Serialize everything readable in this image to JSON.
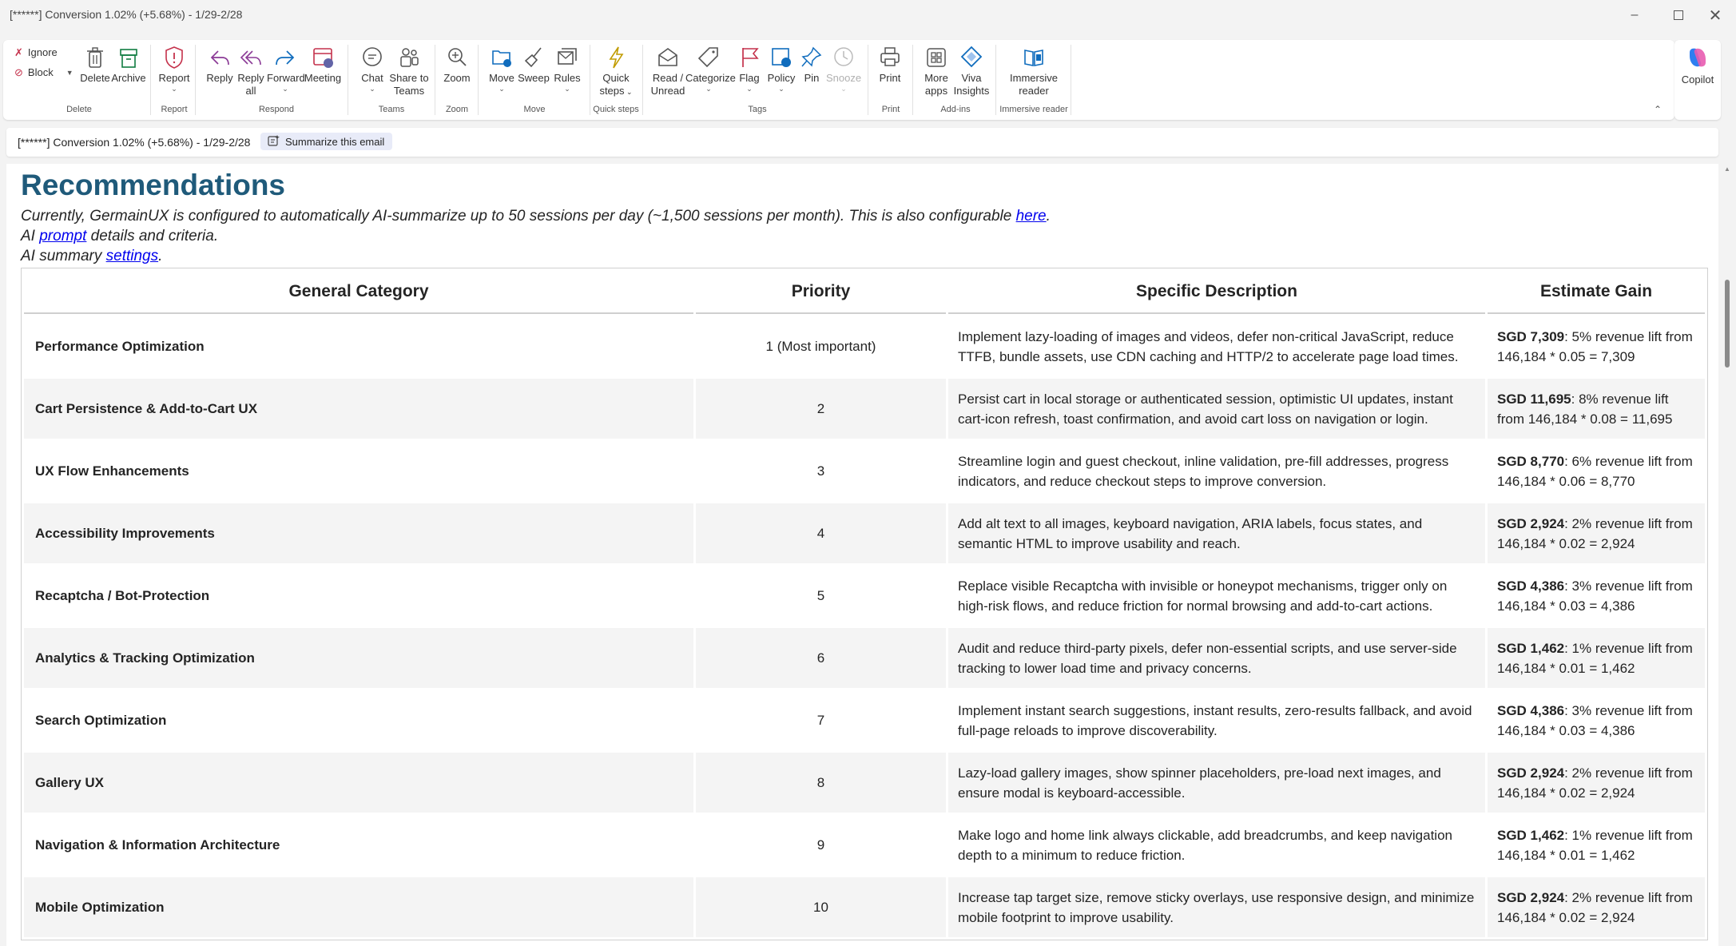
{
  "window": {
    "title": "[******] Conversion 1.02% (+5.68%) - 1/29-2/28",
    "controls": [
      "minimize-icon",
      "maximize-icon",
      "close-icon"
    ]
  },
  "ribbon": {
    "ignore": "Ignore",
    "block": "Block",
    "delete": "Delete",
    "archive": "Archive",
    "report": "Report",
    "reply": "Reply",
    "reply_all_1": "Reply",
    "reply_all_2": "all",
    "forward": "Forward",
    "meeting": "Meeting",
    "chat": "Chat",
    "share_teams_1": "Share to",
    "share_teams_2": "Teams",
    "zoom": "Zoom",
    "move": "Move",
    "sweep": "Sweep",
    "rules": "Rules",
    "quick_steps_1": "Quick",
    "quick_steps_2": "steps",
    "read_unread_1": "Read /",
    "read_unread_2": "Unread",
    "categorize": "Categorize",
    "flag": "Flag",
    "policy": "Policy",
    "pin": "Pin",
    "snooze": "Snooze",
    "print": "Print",
    "more_apps_1": "More",
    "more_apps_2": "apps",
    "viva_1": "Viva",
    "viva_2": "Insights",
    "immersive_1": "Immersive",
    "immersive_2": "reader",
    "copilot": "Copilot",
    "groups": {
      "delete": "Delete",
      "report": "Report",
      "respond": "Respond",
      "teams": "Teams",
      "zoom": "Zoom",
      "move": "Move",
      "quick_steps": "Quick steps",
      "tags": "Tags",
      "print": "Print",
      "addins": "Add-ins",
      "immersive": "Immersive reader"
    },
    "accent": "#0f6cbd"
  },
  "subject_bar": {
    "subject": "[******] Conversion 1.02% (+5.68%) - 1/29-2/28",
    "summarize": "Summarize this email"
  },
  "email": {
    "heading": "Recommendations",
    "line1_pre": "Currently, GermainUX is configured to automatically AI-summarize up to 50 sessions per day (~1,500 sessions per month). This is also configurable ",
    "line1_link": "here",
    "line1_post": ".",
    "line2_pre": "AI ",
    "line2_link": "prompt",
    "line2_post": " details and criteria.",
    "line3_pre": "AI summary ",
    "line3_link": "settings",
    "line3_post": ".",
    "heading_color": "#1f5a7a",
    "table": {
      "headers": [
        "General Category",
        "Priority",
        "Specific Description",
        "Estimate Gain"
      ],
      "rows": [
        {
          "category": "Performance Optimization",
          "priority": "1 (Most important)",
          "description": "Implement lazy-loading of images and videos, defer non-critical JavaScript, reduce TTFB, bundle assets, use CDN caching and HTTP/2 to accelerate page load times.",
          "gain_bold": "SGD 7,309",
          "gain_rest": ": 5% revenue lift from 146,184 * 0.05 = 7,309"
        },
        {
          "category": "Cart Persistence & Add-to-Cart UX",
          "priority": "2",
          "description": "Persist cart in local storage or authenticated session, optimistic UI updates, instant cart-icon refresh, toast confirmation, and avoid cart loss on navigation or login.",
          "gain_bold": "SGD 11,695",
          "gain_rest": ": 8% revenue lift from 146,184 * 0.08 = 11,695"
        },
        {
          "category": "UX Flow Enhancements",
          "priority": "3",
          "description": "Streamline login and guest checkout, inline validation, pre-fill addresses, progress indicators, and reduce checkout steps to improve conversion.",
          "gain_bold": "SGD 8,770",
          "gain_rest": ": 6% revenue lift from 146,184 * 0.06 = 8,770"
        },
        {
          "category": "Accessibility Improvements",
          "priority": "4",
          "description": "Add alt text to all images, keyboard navigation, ARIA labels, focus states, and semantic HTML to improve usability and reach.",
          "gain_bold": "SGD 2,924",
          "gain_rest": ": 2% revenue lift from 146,184 * 0.02 = 2,924"
        },
        {
          "category": "Recaptcha / Bot-Protection",
          "priority": "5",
          "description": "Replace visible Recaptcha with invisible or honeypot mechanisms, trigger only on high-risk flows, and reduce friction for normal browsing and add-to-cart actions.",
          "gain_bold": "SGD 4,386",
          "gain_rest": ": 3% revenue lift from 146,184 * 0.03 = 4,386"
        },
        {
          "category": "Analytics & Tracking Optimization",
          "priority": "6",
          "description": "Audit and reduce third-party pixels, defer non-essential scripts, and use server-side tracking to lower load time and privacy concerns.",
          "gain_bold": "SGD 1,462",
          "gain_rest": ": 1% revenue lift from 146,184 * 0.01 = 1,462"
        },
        {
          "category": "Search Optimization",
          "priority": "7",
          "description": "Implement instant search suggestions, instant results, zero-results fallback, and avoid full-page reloads to improve discoverability.",
          "gain_bold": "SGD 4,386",
          "gain_rest": ": 3% revenue lift from 146,184 * 0.03 = 4,386"
        },
        {
          "category": "Gallery UX",
          "priority": "8",
          "description": "Lazy-load gallery images, show spinner placeholders, pre-load next images, and ensure modal is keyboard-accessible.",
          "gain_bold": "SGD 2,924",
          "gain_rest": ": 2% revenue lift from 146,184 * 0.02 = 2,924"
        },
        {
          "category": "Navigation & Information Architecture",
          "priority": "9",
          "description": "Make logo and home link always clickable, add breadcrumbs, and keep navigation depth to a minimum to reduce friction.",
          "gain_bold": "SGD 1,462",
          "gain_rest": ": 1% revenue lift from 146,184 * 0.01 = 1,462"
        },
        {
          "category": "Mobile Optimization",
          "priority": "10",
          "description": "Increase tap target size, remove sticky overlays, use responsive design, and minimize mobile footprint to improve usability.",
          "gain_bold": "SGD 2,924",
          "gain_rest": ": 2% revenue lift from 146,184 * 0.02 = 2,924"
        }
      ]
    }
  }
}
